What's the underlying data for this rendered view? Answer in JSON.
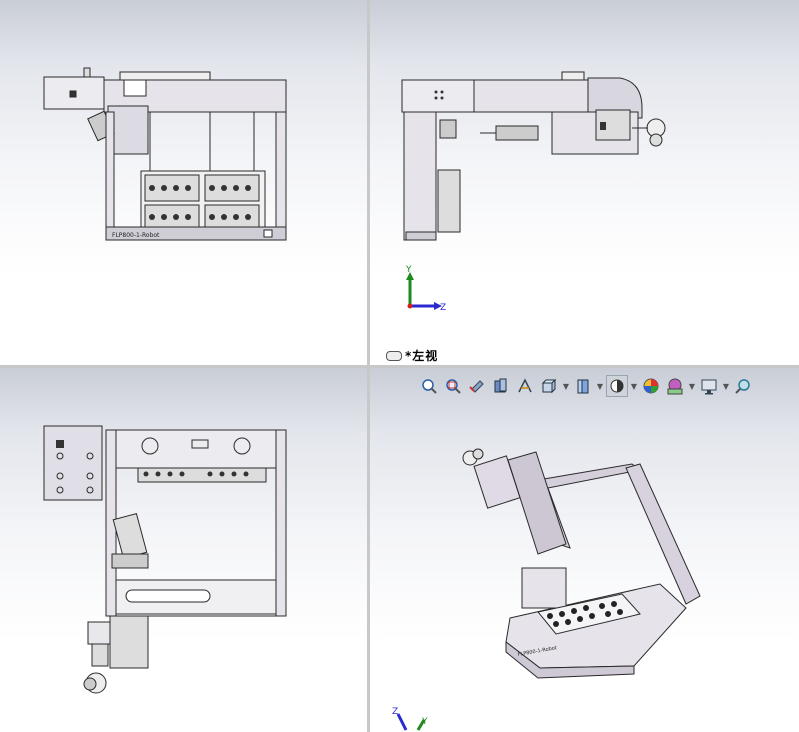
{
  "viewports": {
    "top_left": {
      "name": "front-view",
      "plate_text": "FLP800-1-Robot"
    },
    "top_right": {
      "name": "left-view",
      "view_label": "*左视"
    },
    "bottom_left": {
      "name": "top-view"
    },
    "bottom_right": {
      "name": "isometric-view",
      "plate_text": "FLP800-1-Robot"
    }
  },
  "triad": {
    "top_right": {
      "y": "Y",
      "z": "Z"
    },
    "bottom_right": {
      "z": "Z",
      "y": "Y"
    }
  },
  "toolbar": {
    "icons": [
      "zoom-to-fit-icon",
      "zoom-to-area-icon",
      "previous-view-icon",
      "section-view-icon",
      "dynamic-annotation-icon",
      "view-orientation-icon",
      "display-style-icon",
      "hide-show-items-icon",
      "edit-appearance-icon",
      "apply-scene-icon",
      "view-settings-icon",
      "rotate-view-icon"
    ]
  },
  "colors": {
    "bg_top": "#c9cdd6",
    "bg_bottom": "#ffffff",
    "line": "#2a2a2a",
    "part_fill": "#e6e4ea",
    "frame_fill": "#d8d4df",
    "axis_x": "#d02020",
    "axis_y": "#1e8a1e",
    "axis_z": "#2a2ad0"
  }
}
